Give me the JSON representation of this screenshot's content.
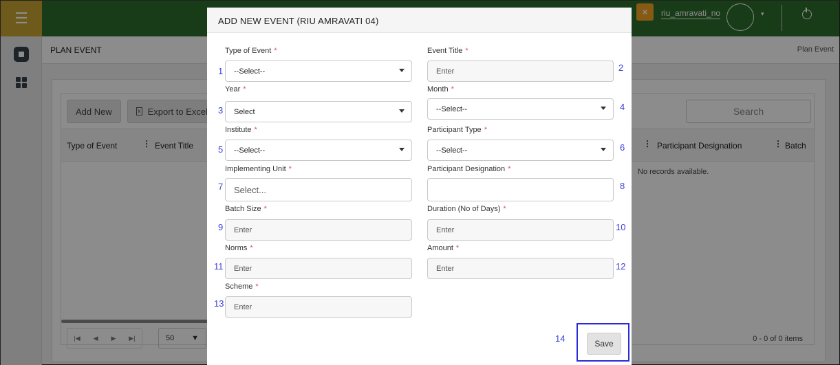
{
  "app": {
    "user": "riu_amravati_no",
    "page_title": "PLAN EVENT",
    "breadcrumb": "Plan Event",
    "brand_color": "#2b6e2b",
    "accent_color": "#c9a632",
    "hamburger_glyph": "☰",
    "close_glyph": "×",
    "caret_glyph": "▾"
  },
  "grid": {
    "add_label": "Add New",
    "export_label": "Export to Excel",
    "search_placeholder": "Search",
    "columns": [
      "Type of Event",
      "Event Title",
      "Participant Designation",
      "Batch"
    ],
    "no_records": "No records available.",
    "page_size": "50",
    "page_info": "0 - 0 of 0 items",
    "pager_icons": [
      "first-page-icon",
      "prev-page-icon",
      "next-page-icon",
      "last-page-icon"
    ]
  },
  "modal": {
    "title": "ADD NEW EVENT (RIU AMRAVATI 04)",
    "required_mark": "*",
    "fields": [
      {
        "label": "Type of Event",
        "value": "--Select--",
        "num": "1"
      },
      {
        "label": "Event Title",
        "placeholder": "Enter",
        "num": "2"
      },
      {
        "label": "Year",
        "value": "Select",
        "num": "3"
      },
      {
        "label": "Month",
        "value": "--Select--",
        "num": "4"
      },
      {
        "label": "Institute",
        "value": "--Select--",
        "num": "5"
      },
      {
        "label": "Participant Type",
        "value": "--Select--",
        "num": "6"
      },
      {
        "label": "Implementing Unit",
        "placeholder": "Select...",
        "num": "7"
      },
      {
        "label": "Participant Designation",
        "value": "",
        "num": "8"
      },
      {
        "label": "Batch Size",
        "placeholder": "Enter",
        "num": "9"
      },
      {
        "label": "Duration (No of Days)",
        "placeholder": "Enter",
        "num": "10"
      },
      {
        "label": "Norms",
        "placeholder": "Enter",
        "num": "11"
      },
      {
        "label": "Amount",
        "placeholder": "Enter",
        "num": "12"
      },
      {
        "label": "Scheme",
        "placeholder": "Enter",
        "num": "13"
      }
    ],
    "save_num": "14",
    "save_label": "Save"
  }
}
